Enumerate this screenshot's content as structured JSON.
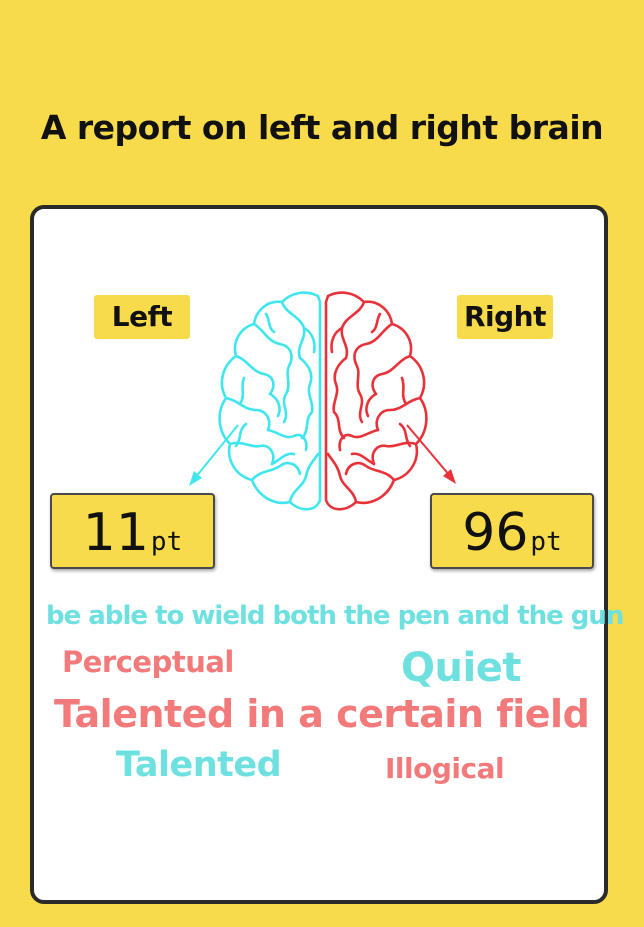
{
  "header": {
    "title": "A report on left and right brain"
  },
  "labels": {
    "left": "Left",
    "right": "Right"
  },
  "scores": {
    "left": {
      "value": "11",
      "unit": "pt"
    },
    "right": {
      "value": "96",
      "unit": "pt"
    }
  },
  "traits": {
    "motto": "be able to wield both the pen and the gun",
    "perceptual": "Perceptual",
    "quiet": "Quiet",
    "talented_field": "Talented in a certain field",
    "talented": "Talented",
    "illogical": "Illogical"
  },
  "icons": {
    "brain": "brain-icon"
  },
  "colors": {
    "background": "#f8db4b",
    "left_brain": "#3fe6ee",
    "right_brain": "#e8323a",
    "trait_cyan": "#6fe0e0",
    "trait_red": "#f27a7a"
  }
}
